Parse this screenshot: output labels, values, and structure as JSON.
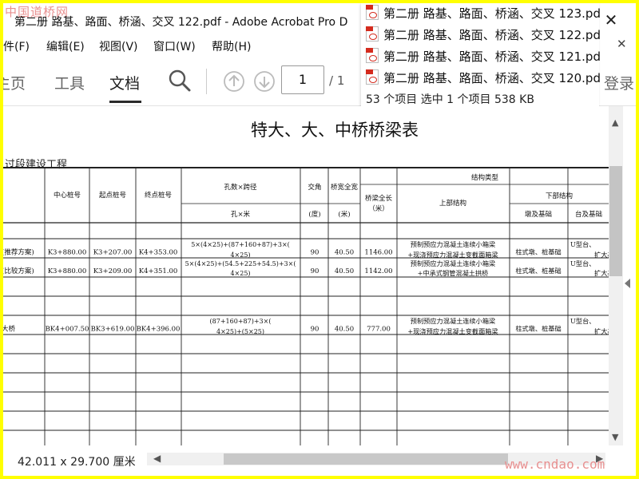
{
  "watermark_top": "中国道桥网",
  "watermark_bottom": "www.cndao.com",
  "window": {
    "title": "第二册 路基、路面、桥涵、交叉 122.pdf - Adobe Acrobat Pro D"
  },
  "menu": [
    "件(F)",
    "编辑(E)",
    "视图(V)",
    "窗口(W)",
    "帮助(H)"
  ],
  "toolbar": {
    "tabs": [
      "主页",
      "工具",
      "文档"
    ],
    "active_tab": "文档",
    "page_current": "1",
    "page_total": "/ 1",
    "login_label": "登录"
  },
  "explorer_popup": {
    "files": [
      "第二册 路基、路面、桥涵、交叉 123.pd",
      "第二册 路基、路面、桥涵、交叉 122.pd",
      "第二册 路基、路面、桥涵、交叉 121.pd",
      "第二册 路基、路面、桥涵、交叉 120.pd"
    ],
    "status": "53 个项目    选中 1 个项目  538 KB"
  },
  "document": {
    "title": "特大、大、中桥桥梁表",
    "subtitle": "过段建设工程",
    "headers": {
      "center_pile": "中心桩号",
      "start_pile": "起点桩号",
      "end_pile": "终点桩号",
      "spans": "孔数×跨径",
      "spans_unit": "孔×米",
      "angle": "交角",
      "angle_unit": "(度)",
      "width": "桥宽全宽",
      "width_unit": "(米)",
      "length": "桥梁全长（米）",
      "structure_type": "结构类型",
      "super": "上部结构",
      "sub": "下部结构",
      "pier": "墩及基础",
      "abutment": "台及基础"
    },
    "rows": [
      {
        "name": "(推荐方案)",
        "center": "K3+880.00",
        "start": "K3+207.00",
        "end": "K4+353.00",
        "spans": "5×(4×25)+(87+160+87)+3×(4×25)",
        "angle": "90",
        "width": "40.50",
        "length": "1146.00",
        "super": "预制预应力混凝土连续小箱梁+现浇预应力混凝土变截面箱梁",
        "pier": "柱式墩、桩基础",
        "abutment": "U型台、扩大基础"
      },
      {
        "name": "(比较方案)",
        "center": "K3+880.00",
        "start": "K3+209.00",
        "end": "K4+351.00",
        "spans": "5×(4×25)+(54.5+225+54.5)+3×(4×25)",
        "angle": "90",
        "width": "40.50",
        "length": "1142.00",
        "super": "预制预应力混凝土连续小箱梁+中承式钢管混凝土拱桥",
        "pier": "柱式墩、桩基础",
        "abutment": "U型台、扩大基础"
      },
      {
        "name": "大桥",
        "center": "BK4+007.50",
        "start": "BK3+619.00",
        "end": "BK4+396.00",
        "spans": "(87+160+87)+3×(4×25)+(5×25)",
        "angle": "90",
        "width": "40.50",
        "length": "777.00",
        "super": "预制预应力混凝土连续小箱梁+现浇预应力混凝土变截面箱梁",
        "pier": "柱式墩、桩基础",
        "abutment": "U型台、扩大基础"
      }
    ]
  },
  "statusbar": {
    "dimensions": "42.011 x 29.700 厘米"
  }
}
